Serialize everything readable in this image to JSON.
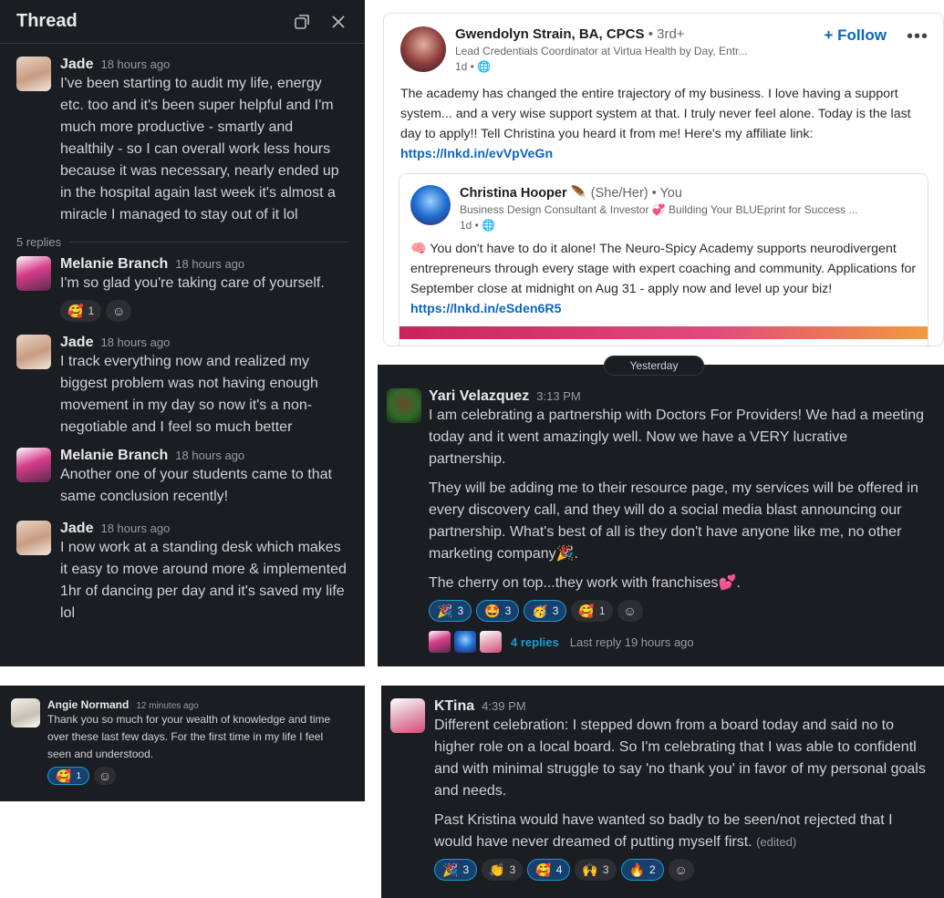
{
  "thread": {
    "title": "Thread",
    "replies_label": "5 replies",
    "messages": [
      {
        "author": "Jade",
        "time": "18 hours ago",
        "text": "I've been starting to audit my life, energy etc. too and it's been super helpful and I'm much more productive - smartly and healthily - so I can overall work less hours because it was necessary, nearly ended up in the hospital again last week it's almost a miracle I managed to stay out of it lol"
      },
      {
        "author": "Melanie Branch",
        "time": "18 hours ago",
        "text": "I'm so glad you're taking care of yourself.",
        "reactions": [
          {
            "emoji": "🥰",
            "count": "1"
          }
        ]
      },
      {
        "author": "Jade",
        "time": "18 hours ago",
        "text": "I track everything now and realized my biggest problem was not having enough movement in my day so now it's a non-negotiable and I feel so much better"
      },
      {
        "author": "Melanie Branch",
        "time": "18 hours ago",
        "text": "Another one of your students came to that same conclusion recently!"
      },
      {
        "author": "Jade",
        "time": "18 hours ago",
        "text": "I now work at a standing desk which makes it easy to move around more & implemented 1hr of dancing per day and it's saved my life lol"
      }
    ]
  },
  "linkedin": {
    "author": "Gwendolyn Strain, BA, CPCS",
    "degree": "• 3rd+",
    "headline": "Lead Credentials Coordinator at Virtua Health by Day, Entr...",
    "age": "1d •",
    "follow_label": "+ Follow",
    "more_label": "•••",
    "text": "The academy has changed the entire trajectory of my business. I love having a support system... and a very wise support system at that. I truly never feel alone. Today is the last day to apply!! Tell Christina you heard it from me! Here's my affiliate link: ",
    "link": "https://lnkd.in/evVpVeGn",
    "shared": {
      "author": "Christina Hooper",
      "author_emoji": "🪶",
      "pronouns": "(She/Her) • You",
      "headline": "Business Design Consultant & Investor 💞 Building Your BLUEprint for Success ...",
      "age": "1d •",
      "text": "🧠 You don't have to do it alone! The Neuro-Spicy Academy supports neurodivergent entrepreneurs through every stage with expert coaching and community. Applications for September close at midnight on Aug 31 - apply now and level up your biz! ",
      "link": "https://lnkd.in/eSden6R5"
    }
  },
  "yari": {
    "date_pill": "Yesterday",
    "author": "Yari Velazquez",
    "time": "3:13 PM",
    "p1": "I am celebrating a partnership with Doctors For Providers! We had a meeting today and it went amazingly well. Now we have a VERY lucrative partnership.",
    "p2": "They will be adding me to their resource page, my services will be offered in every discovery call, and they will do a social media blast announcing our partnership. What's best of all is they don't have anyone like me, no other marketing company🎉.",
    "p3": "The cherry on top...they work with franchises💕.",
    "reactions": [
      {
        "emoji": "🎉",
        "count": "3",
        "mine": true
      },
      {
        "emoji": "🤩",
        "count": "3",
        "mine": true
      },
      {
        "emoji": "🥳",
        "count": "3",
        "mine": true
      },
      {
        "emoji": "🥰",
        "count": "1",
        "mine": false
      }
    ],
    "replies_link": "4 replies",
    "last_reply": "Last reply 19 hours ago"
  },
  "angie": {
    "author": "Angie Normand",
    "time": "12 minutes ago",
    "text": "Thank you so much for your wealth of knowledge and time over these last few days. For the first time in my life I feel seen and understood.",
    "reactions": [
      {
        "emoji": "🥰",
        "count": "1"
      }
    ]
  },
  "ktina": {
    "author": "KTina",
    "time": "4:39 PM",
    "p1": "Different celebration: I stepped down from a board today and said no to higher role on a local board. So I'm celebrating that I was able to confidentl and with minimal struggle to say 'no thank you' in favor of my personal goals and needs.",
    "p2": "Past Kristina would have wanted so badly to be seen/not rejected that I would have never dreamed of putting myself first.",
    "edited": "(edited)",
    "reactions": [
      {
        "emoji": "🎉",
        "count": "3",
        "mine": true
      },
      {
        "emoji": "👏",
        "count": "3",
        "mine": false
      },
      {
        "emoji": "🥰",
        "count": "4",
        "mine": true
      },
      {
        "emoji": "🙌",
        "count": "3",
        "mine": false
      },
      {
        "emoji": "🔥",
        "count": "2",
        "mine": true
      }
    ]
  }
}
